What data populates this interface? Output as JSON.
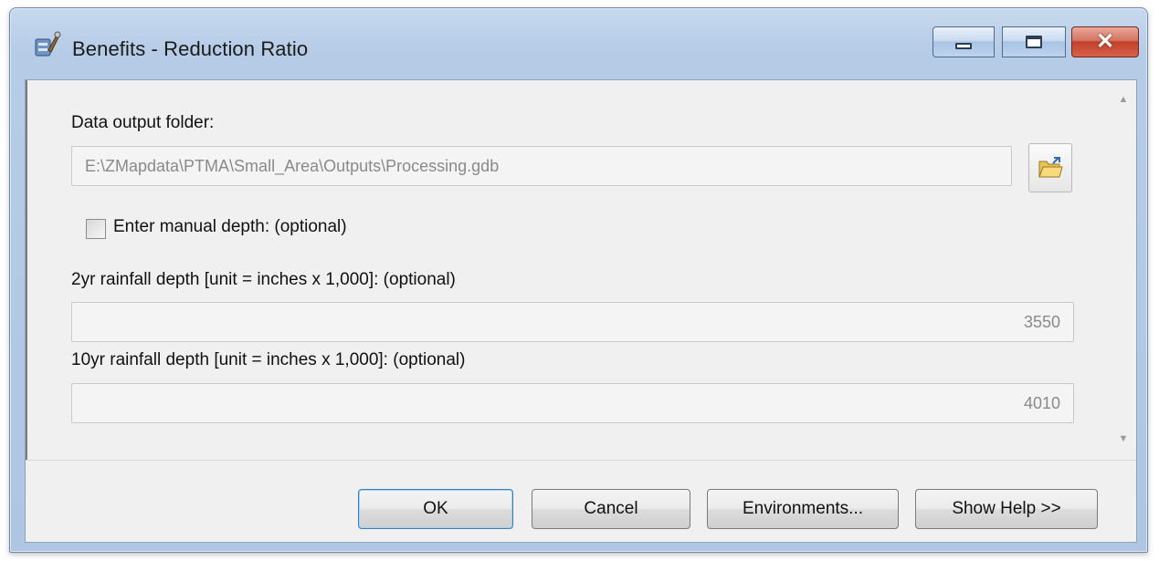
{
  "window": {
    "title": "Benefits - Reduction Ratio",
    "caption_buttons": {
      "minimize": "minimize-icon",
      "maximize": "maximize-icon",
      "close": "close-icon"
    }
  },
  "form": {
    "output_folder": {
      "label": "Data output folder:",
      "value": "E:\\ZMapdata\\PTMA\\Small_Area\\Outputs\\Processing.gdb"
    },
    "manual_depth": {
      "label": "Enter manual depth: (optional)",
      "checked": false
    },
    "rain_2yr": {
      "label": "2yr rainfall depth [unit = inches x 1,000]: (optional)",
      "value": "3550"
    },
    "rain_10yr": {
      "label": "10yr rainfall depth [unit = inches x 1,000]: (optional)",
      "value": "4010"
    }
  },
  "buttons": {
    "ok": "OK",
    "cancel": "Cancel",
    "environments": "Environments...",
    "show_help": "Show Help >>"
  },
  "colors": {
    "title_bar": "#b6cce6",
    "close_button": "#c2402a",
    "dialog_background": "#f0f0f0"
  }
}
